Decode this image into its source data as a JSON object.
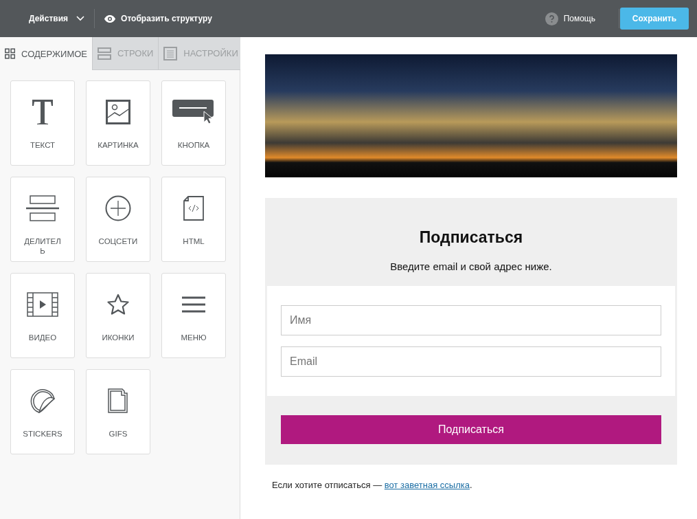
{
  "toolbar": {
    "actions": "Действия",
    "structure": "Отобразить структуру",
    "help": "Помощь",
    "save": "Сохранить"
  },
  "tabs": [
    {
      "label": "СОДЕРЖИМОЕ",
      "kind": "grid",
      "selected": true
    },
    {
      "label": "СТРОКИ",
      "kind": "rows",
      "selected": false
    },
    {
      "label": "НАСТРОЙКИ",
      "kind": "settings",
      "selected": false
    }
  ],
  "blocks": [
    {
      "label": "ТЕКСТ",
      "kind": "text"
    },
    {
      "label": "КАРТИНКА",
      "kind": "image"
    },
    {
      "label": "КНОПКА",
      "kind": "button"
    },
    {
      "label": "ДЕЛИТЕЛЬ",
      "kind": "divider"
    },
    {
      "label": "СОЦСЕТИ",
      "kind": "social"
    },
    {
      "label": "HTML",
      "kind": "html"
    },
    {
      "label": "ВИДЕО",
      "kind": "video"
    },
    {
      "label": "ИКОНКИ",
      "kind": "icons"
    },
    {
      "label": "МЕНЮ",
      "kind": "menu"
    },
    {
      "label": "STICKERS",
      "kind": "stickers"
    },
    {
      "label": "GIFS",
      "kind": "gifs"
    }
  ],
  "email": {
    "title": "Подписаться",
    "subtitle": "Введите email и свой адрес ниже.",
    "fields": [
      {
        "placeholder": "Имя"
      },
      {
        "placeholder": "Email"
      }
    ],
    "button": "Подписаться",
    "footer_text": "Если хотите отписаться — ",
    "footer_link": "вот заветная ссылка",
    "footer_end": "."
  }
}
